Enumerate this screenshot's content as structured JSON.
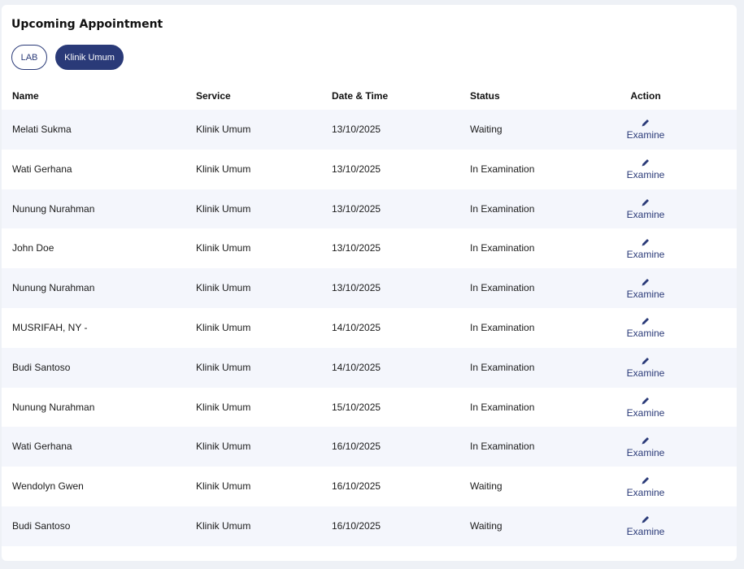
{
  "header": {
    "title": "Upcoming Appointment"
  },
  "tabs": [
    {
      "label": "LAB",
      "active": false
    },
    {
      "label": "Klinik Umum",
      "active": true
    }
  ],
  "columns": {
    "name": "Name",
    "service": "Service",
    "datetime": "Date & Time",
    "status": "Status",
    "action": "Action"
  },
  "rows": [
    {
      "name": "Melati Sukma",
      "service": "Klinik Umum",
      "datetime": "13/10/2025",
      "status": "Waiting",
      "action": "Examine"
    },
    {
      "name": "Wati Gerhana",
      "service": "Klinik Umum",
      "datetime": "13/10/2025",
      "status": "In Examination",
      "action": "Examine"
    },
    {
      "name": "Nunung Nurahman",
      "service": "Klinik Umum",
      "datetime": "13/10/2025",
      "status": "In Examination",
      "action": "Examine"
    },
    {
      "name": "John Doe",
      "service": "Klinik Umum",
      "datetime": "13/10/2025",
      "status": "In Examination",
      "action": "Examine"
    },
    {
      "name": "Nunung Nurahman",
      "service": "Klinik Umum",
      "datetime": "13/10/2025",
      "status": "In Examination",
      "action": "Examine"
    },
    {
      "name": "MUSRIFAH, NY -",
      "service": "Klinik Umum",
      "datetime": "14/10/2025",
      "status": "In Examination",
      "action": "Examine"
    },
    {
      "name": "Budi Santoso",
      "service": "Klinik Umum",
      "datetime": "14/10/2025",
      "status": "In Examination",
      "action": "Examine"
    },
    {
      "name": "Nunung Nurahman",
      "service": "Klinik Umum",
      "datetime": "15/10/2025",
      "status": "In Examination",
      "action": "Examine"
    },
    {
      "name": "Wati Gerhana",
      "service": "Klinik Umum",
      "datetime": "16/10/2025",
      "status": "In Examination",
      "action": "Examine"
    },
    {
      "name": "Wendolyn Gwen",
      "service": "Klinik Umum",
      "datetime": "16/10/2025",
      "status": "Waiting",
      "action": "Examine"
    },
    {
      "name": "Budi Santoso",
      "service": "Klinik Umum",
      "datetime": "16/10/2025",
      "status": "Waiting",
      "action": "Examine"
    }
  ],
  "icons": {
    "action": "pencil-icon"
  },
  "colors": {
    "accent": "#2a3a78",
    "row_alt": "#f4f6fc",
    "background": "#eef1f6"
  }
}
